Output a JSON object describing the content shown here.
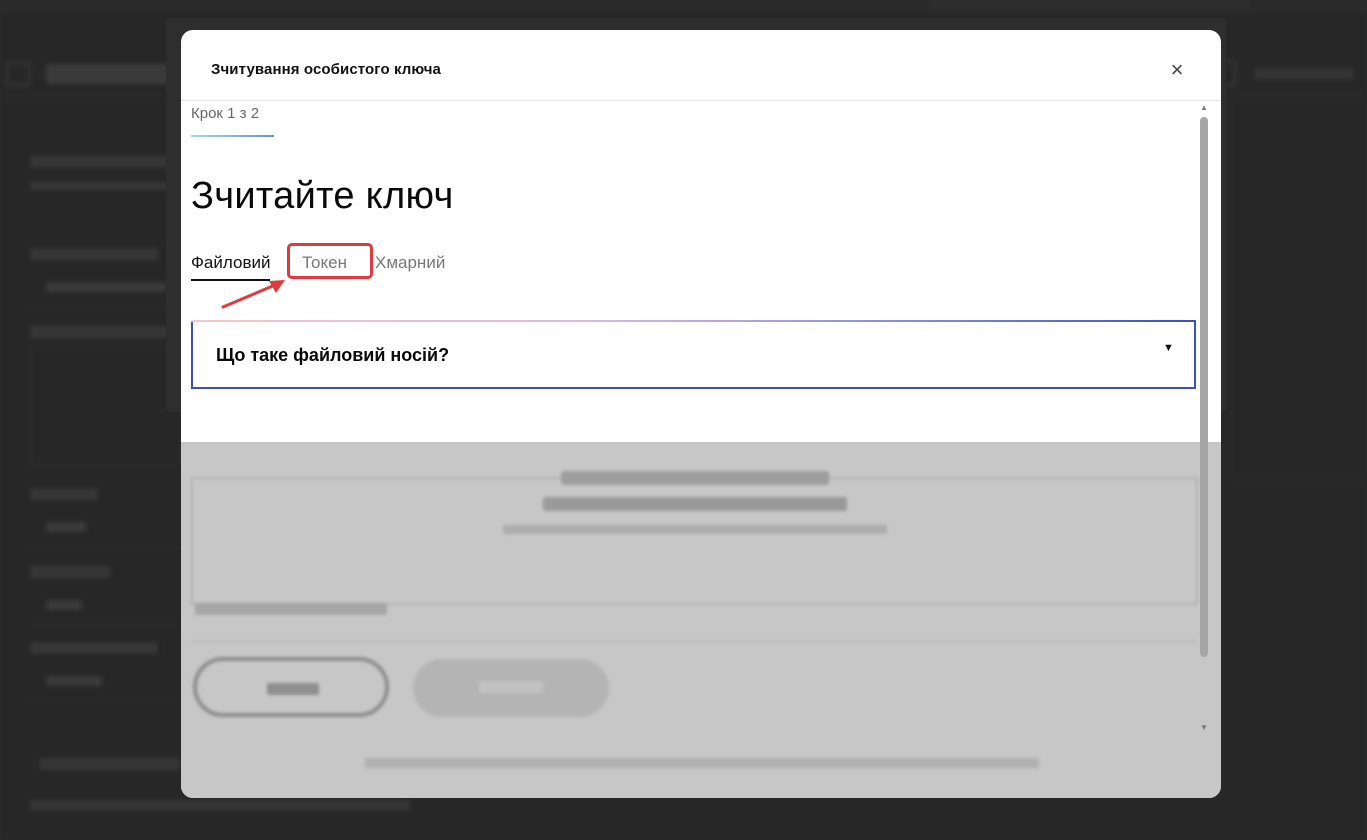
{
  "modal": {
    "title": "Зчитування особистого ключа",
    "close_glyph": "×",
    "step_label": "Крок 1 з 2",
    "heading": "Зчитайте ключ",
    "tabs": [
      {
        "label": "Файловий",
        "active": true
      },
      {
        "label": "Токен",
        "active": false,
        "highlighted": true
      },
      {
        "label": "Хмарний",
        "active": false
      }
    ],
    "faq": {
      "question": "Що таке файловий носій?",
      "caret": "▼"
    },
    "scroll": {
      "up": "▲",
      "down": "▼"
    }
  },
  "colors": {
    "accent": "#3e4fb6",
    "annotation": "#e0393e"
  },
  "icons": {
    "close": "close-icon",
    "caret": "chevron-down-icon",
    "annotation": "arrow-annotation-icon"
  }
}
